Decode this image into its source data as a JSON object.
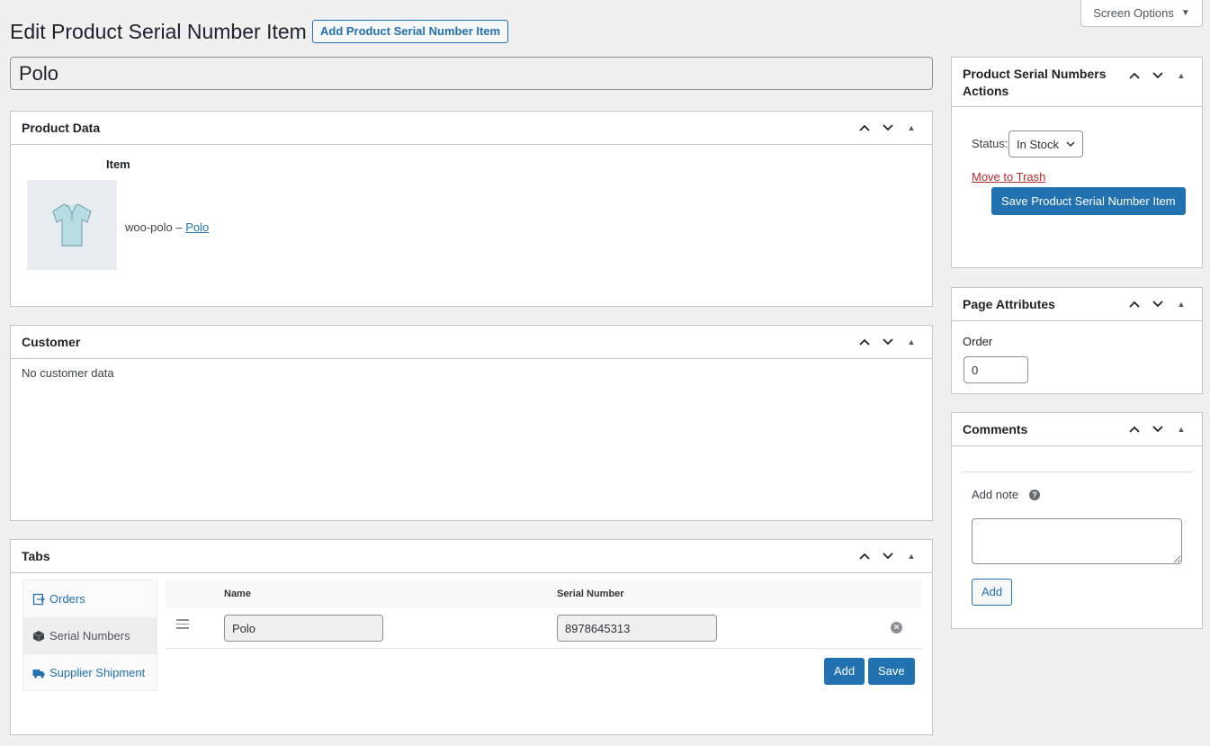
{
  "screen_options": {
    "label": "Screen Options"
  },
  "page": {
    "title": "Edit Product Serial Number Item",
    "add_new_label": "Add Product Serial Number Item",
    "post_title": "Polo"
  },
  "product_data": {
    "heading": "Product Data",
    "item_column": "Item",
    "item_sku": "woo-polo –",
    "item_link": "Polo"
  },
  "customer": {
    "heading": "Customer",
    "empty_text": "No customer data"
  },
  "tabs": {
    "heading": "Tabs",
    "nav": [
      {
        "label": "Orders",
        "icon": "orders-icon"
      },
      {
        "label": "Serial Numbers",
        "icon": "box-icon"
      },
      {
        "label": "Supplier Shipment",
        "icon": "truck-icon"
      }
    ],
    "active_tab": "Serial Numbers",
    "table": {
      "columns": [
        "Name",
        "Serial Number"
      ],
      "rows": [
        {
          "name": "Polo",
          "serial_number": "8978645313"
        }
      ]
    },
    "add_label": "Add",
    "save_label": "Save"
  },
  "actions_box": {
    "heading": "Product Serial Numbers Actions",
    "status_label": "Status:",
    "status_value": "In Stock",
    "trash_label": "Move to Trash",
    "save_label": "Save Product Serial Number Item"
  },
  "page_attributes": {
    "heading": "Page Attributes",
    "order_label": "Order",
    "order_value": "0"
  },
  "comments": {
    "heading": "Comments",
    "add_note_label": "Add note",
    "add_label": "Add"
  },
  "colors": {
    "accent": "#2271b1",
    "danger": "#b32d2e",
    "background": "#f0f0f1"
  }
}
